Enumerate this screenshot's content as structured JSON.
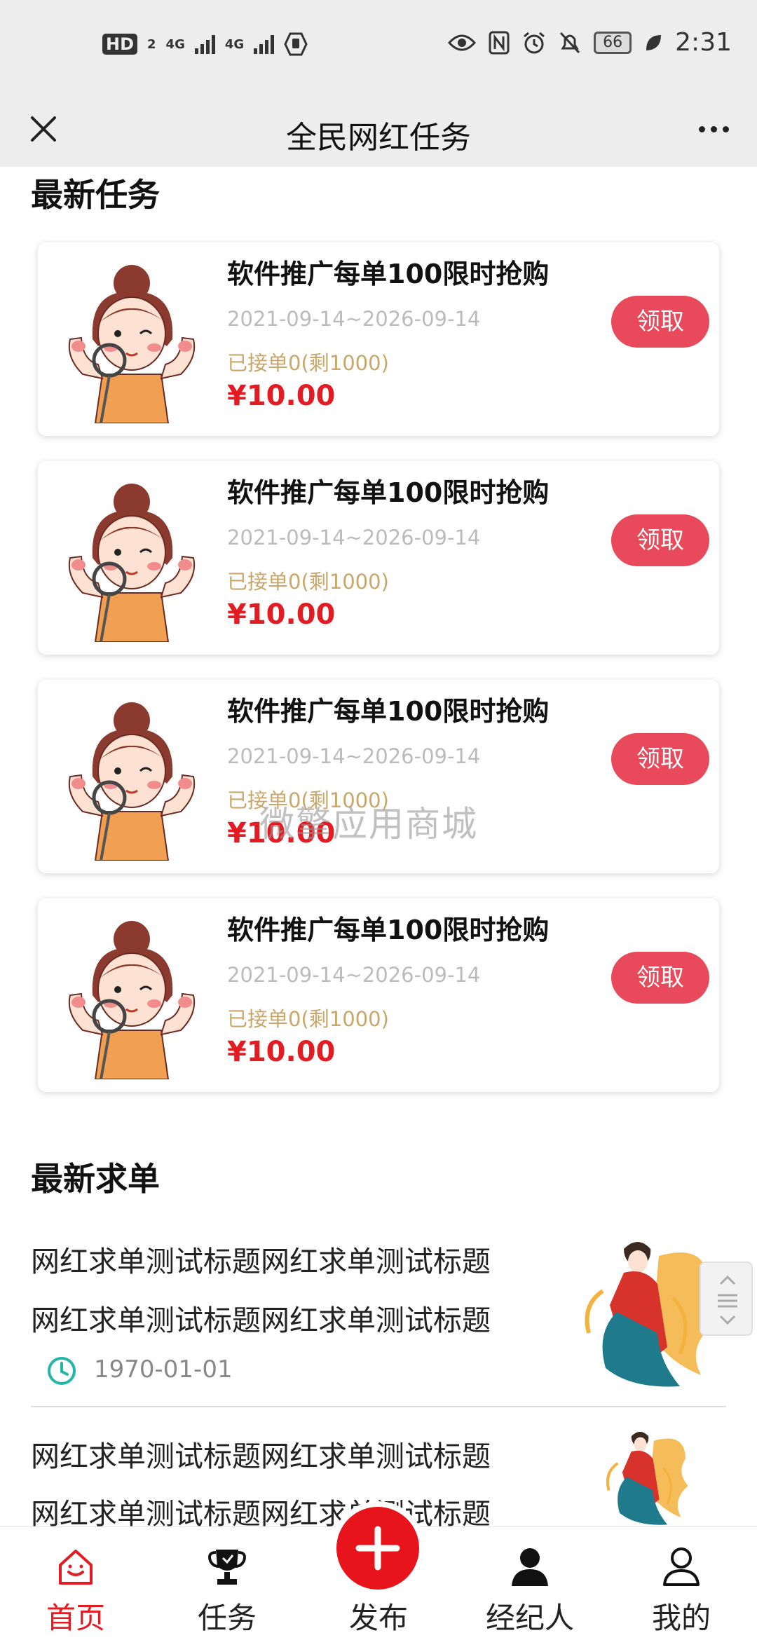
{
  "status_bar": {
    "hd": "HD",
    "hd_sub": "2",
    "net1": "4G",
    "net2": "4G",
    "battery": "66",
    "time": "2:31"
  },
  "title_bar": {
    "title": "全民网红任务"
  },
  "latest_tasks": {
    "heading": "最新任务",
    "claim_label": "领取",
    "items": [
      {
        "title": "软件推广每单100限时抢购",
        "date_range": "2021-09-14~2026-09-14",
        "taken": "已接单0(剩1000)",
        "price": "¥10.00"
      },
      {
        "title": "软件推广每单100限时抢购",
        "date_range": "2021-09-14~2026-09-14",
        "taken": "已接单0(剩1000)",
        "price": "¥10.00"
      },
      {
        "title": "软件推广每单100限时抢购",
        "date_range": "2021-09-14~2026-09-14",
        "taken": "已接单0(剩1000)",
        "price": "¥10.00"
      },
      {
        "title": "软件推广每单100限时抢购",
        "date_range": "2021-09-14~2026-09-14",
        "taken": "已接单0(剩1000)",
        "price": "¥10.00"
      }
    ]
  },
  "watermark": "微擎应用商城",
  "latest_requests": {
    "heading": "最新求单",
    "items": [
      {
        "line1": "网红求单测试标题网红求单测试标题",
        "line2": "网红求单测试标题网红求单测试标题",
        "date": "1970-01-01"
      },
      {
        "line1": "网红求单测试标题网红求单测试标题",
        "line2": "网红求单测试标题网红求单测试标题"
      }
    ]
  },
  "bottom_nav": {
    "items": [
      {
        "label": "首页",
        "icon": "home-icon",
        "active": true
      },
      {
        "label": "任务",
        "icon": "trophy-icon",
        "active": false
      },
      {
        "label": "发布",
        "icon": "plus-icon",
        "active": false
      },
      {
        "label": "经纪人",
        "icon": "person-icon",
        "active": false
      },
      {
        "label": "我的",
        "icon": "user-outline-icon",
        "active": false
      }
    ]
  },
  "colors": {
    "accent": "#e31b23",
    "claim_button": "#e84a5b",
    "taken_text": "#c9a76a",
    "header_bg": "#ededed"
  }
}
